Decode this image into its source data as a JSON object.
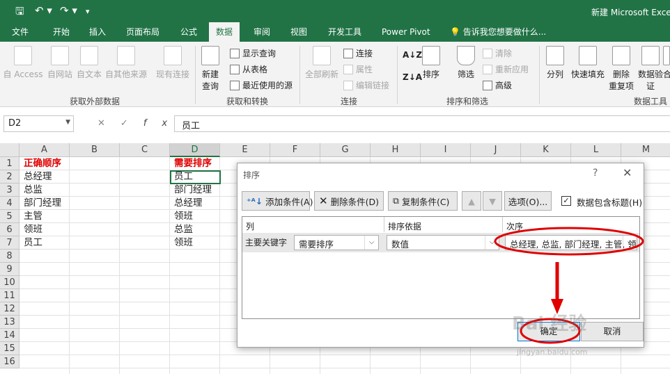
{
  "titlebar": {
    "window_title": "新建 Microsoft Exce"
  },
  "tabs": [
    "文件",
    "开始",
    "插入",
    "页面布局",
    "公式",
    "数据",
    "审阅",
    "视图",
    "开发工具",
    "Power Pivot"
  ],
  "tell_me": "告诉我您想要做什么...",
  "ribbon": {
    "get_external": {
      "access": "自 Access",
      "web": "自网站",
      "text": "自文本",
      "other": "自其他来源",
      "existing": "现有连接",
      "group": "获取外部数据"
    },
    "get_transform": {
      "new_query_1": "新建",
      "new_query_2": "查询",
      "show_query": "显示查询",
      "from_table": "从表格",
      "recent": "最近使用的源",
      "group": "获取和转换"
    },
    "connections": {
      "refresh_all": "全部刷新",
      "connections": "连接",
      "properties": "属性",
      "edit_links": "编辑链接",
      "group": "连接"
    },
    "sort_filter": {
      "sort": "排序",
      "filter": "筛选",
      "clear": "清除",
      "reapply": "重新应用",
      "advanced": "高级",
      "group": "排序和筛选"
    },
    "data_tools": {
      "split": "分列",
      "flash_fill": "快速填充",
      "remove_dup_1": "删除",
      "remove_dup_2": "重复项",
      "validation_1": "数据验",
      "validation_2": "证",
      "consolidate": "合",
      "group": "数据工具"
    }
  },
  "formula_bar": {
    "name_box": "D2",
    "fx": "fx",
    "content": "员工"
  },
  "columns": [
    "A",
    "B",
    "C",
    "D",
    "E",
    "F",
    "G",
    "H",
    "I",
    "J",
    "K",
    "L",
    "M"
  ],
  "rows": [
    "1",
    "2",
    "3",
    "4",
    "5",
    "6",
    "7",
    "8",
    "9",
    "10",
    "11",
    "12",
    "13",
    "14",
    "15",
    "16"
  ],
  "cells_a": [
    "正确顺序",
    "总经理",
    "总监",
    "部门经理",
    "主管",
    "领班",
    "员工"
  ],
  "cells_d": [
    "需要排序",
    "员工",
    "部门经理",
    "总经理",
    "领班",
    "总监",
    "领班"
  ],
  "dialog": {
    "title": "排序",
    "help": "?",
    "close": "✕",
    "add_level": "添加条件(A)",
    "delete_level": "删除条件(D)",
    "copy_level": "复制条件(C)",
    "options": "选项(O)...",
    "has_headers": "数据包含标题(H)",
    "col_header": "列",
    "sort_on_header": "排序依据",
    "order_header": "次序",
    "row_label": "主要关键字",
    "column_value": "需要排序",
    "sort_on_value": "数值",
    "order_value": "总经理, 总监, 部门经理, 主管, 领",
    "ok": "确定",
    "cancel": "取消"
  },
  "watermark": {
    "brand": "Bai 经验",
    "url": "jingyan.baidu.com"
  },
  "colors": {
    "excel_green": "#217346",
    "annotation_red": "#e00000"
  }
}
